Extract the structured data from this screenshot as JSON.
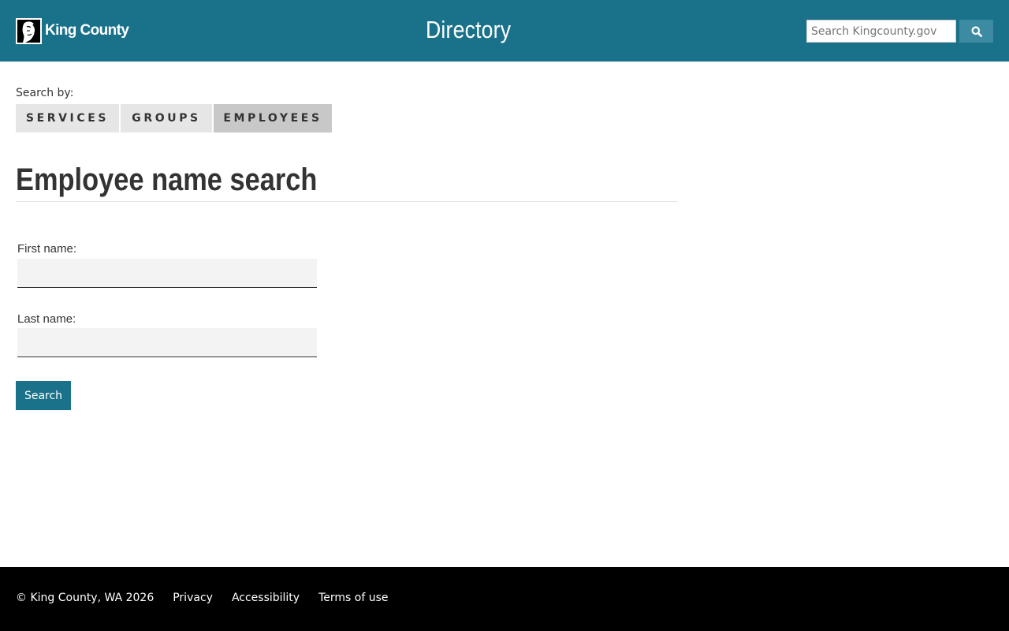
{
  "header": {
    "logo_text": "King County",
    "site_title": "Directory",
    "search": {
      "placeholder": "Search Kingcounty.gov",
      "value": ""
    },
    "search_button_icon": "search-icon",
    "background_color": "#1a718a"
  },
  "search_by": {
    "label": "Search by:",
    "tabs": [
      {
        "label": "SERVICES",
        "active": false
      },
      {
        "label": "GROUPS",
        "active": false
      },
      {
        "label": "EMPLOYEES",
        "active": true
      }
    ]
  },
  "main": {
    "heading": "Employee name search",
    "first_name_label": "First name:",
    "first_name_value": "",
    "last_name_label": "Last name:",
    "last_name_value": "",
    "submit_label": "Search"
  },
  "footer": {
    "copyright": "© King County, WA 2026",
    "links": [
      "Privacy",
      "Accessibility",
      "Terms of use"
    ]
  }
}
